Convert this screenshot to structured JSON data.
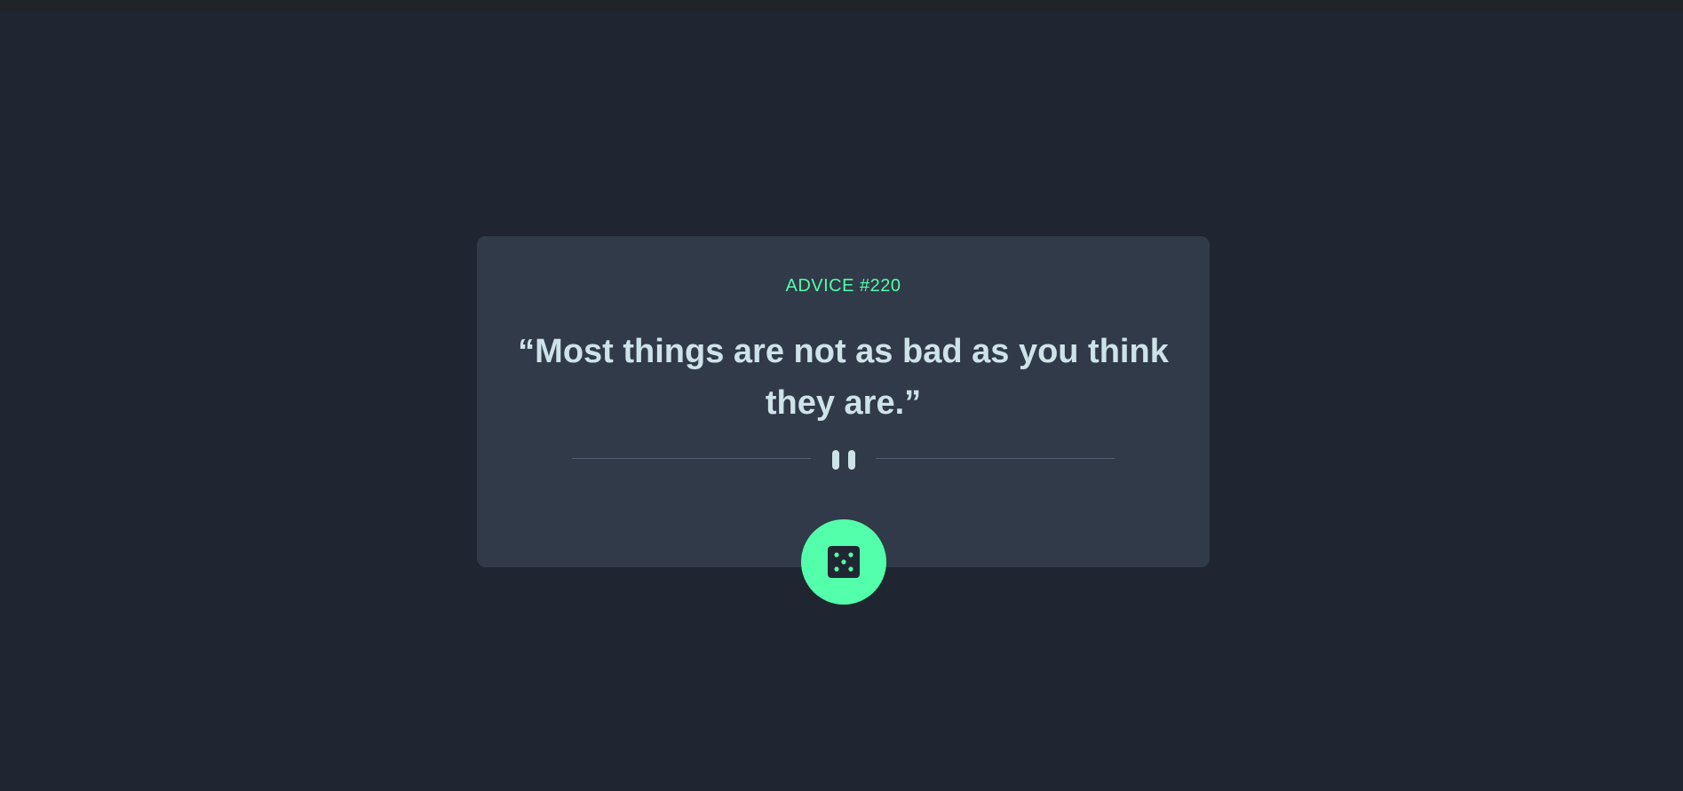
{
  "colors": {
    "background": "#1f2632",
    "card": "#313a48",
    "accent": "#53ffaa",
    "text": "#cee3e9",
    "divider": "#4f5d74"
  },
  "advice": {
    "label": "ADVICE #",
    "id": "220",
    "quote": "“Most things are not as bad as you think they are.”"
  },
  "divider": {
    "icon": "pause-icon"
  },
  "button": {
    "icon": "dice-icon"
  }
}
